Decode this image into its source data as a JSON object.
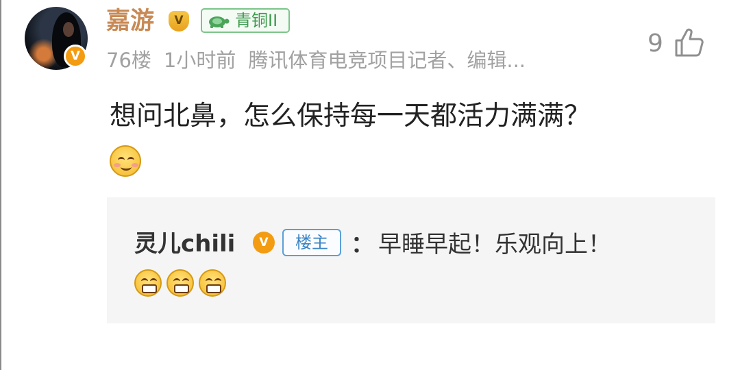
{
  "comment": {
    "username": "嘉游",
    "verified_badge": "V",
    "level_badge": "青铜II",
    "floor": "76楼",
    "time": "1小时前",
    "author_info": "腾讯体育电竞项目记者、编辑...",
    "like_count": "9",
    "text": "想问北鼻，怎么保持每一天都活力满满？",
    "emojis": [
      "smile-emoji"
    ]
  },
  "reply": {
    "username": "灵儿chili",
    "verified_badge": "V",
    "owner_label": "楼主",
    "colon": "：",
    "text": "早睡早起！乐观向上！",
    "emojis": [
      "grin-emoji",
      "grin-emoji",
      "grin-emoji"
    ]
  },
  "colors": {
    "username": "#c88a55",
    "verified": "#f39c12",
    "level_green": "#3e9a4f",
    "owner_blue": "#3b84c4",
    "reply_bg": "#f5f5f5"
  }
}
